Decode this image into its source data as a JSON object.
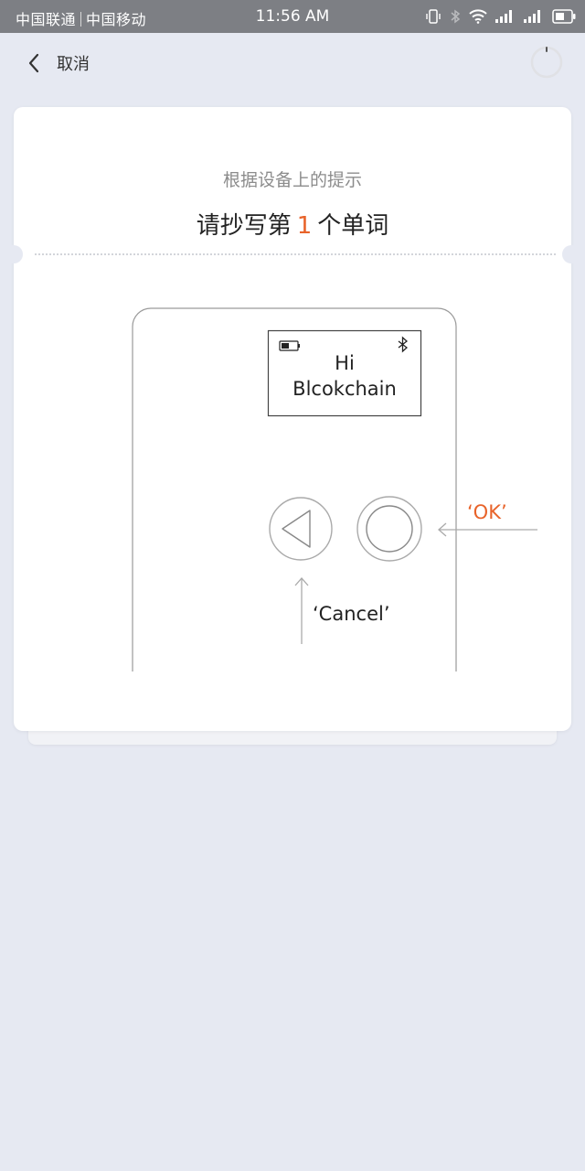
{
  "status_bar": {
    "carrier_1": "中国联通",
    "carrier_2": "中国移动",
    "time": "11:56 AM"
  },
  "nav": {
    "back_label": "取消"
  },
  "card": {
    "hint": "根据设备上的提示",
    "instruction_prefix": "请抄写第",
    "word_number": "1",
    "instruction_suffix": "个单词"
  },
  "device": {
    "screen_line_1": "Hi",
    "screen_line_2": "Blcokchain",
    "ok_label": "‘OK’",
    "cancel_label": "‘Cancel’"
  },
  "colors": {
    "accent": "#e8632a",
    "background": "#e6e9f2",
    "status_bar": "#7d7f84"
  }
}
